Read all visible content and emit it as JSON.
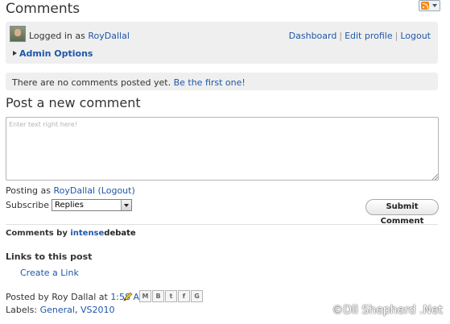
{
  "header": {
    "title": "Comments",
    "rss_icon": "rss-feed-icon"
  },
  "login": {
    "prefix": "Logged in as",
    "username": "RoyDallal",
    "links": [
      "Dashboard",
      "Edit profile",
      "Logout"
    ],
    "admin_options": "Admin Options"
  },
  "no_comments": {
    "text": "There are no comments posted yet.",
    "cta": "Be the first one!"
  },
  "compose": {
    "title": "Post a new comment",
    "placeholder": "Enter text right here!",
    "posting_as_prefix": "Posting as",
    "posting_as_user": "RoyDallal",
    "logout_label": "(Logout)",
    "subscribe_label": "Subscribe to",
    "subscribe_value": "Replies",
    "submit_label": "Submit Comment"
  },
  "comments_by": {
    "prefix": "Comments by",
    "logo_intense": "intense",
    "logo_debate": "debate"
  },
  "links_section": {
    "heading": "Links to this post",
    "create_link": "Create a Link"
  },
  "post_footer": {
    "posted_by": "Posted by Roy Dallal at",
    "time": "1:58 AM",
    "share_buttons": [
      "M",
      "B",
      "t",
      "f",
      "G"
    ],
    "labels_prefix": "Labels:",
    "labels": [
      "General",
      "VS2010"
    ]
  },
  "watermark": "©Dll Shepherd .Net"
}
